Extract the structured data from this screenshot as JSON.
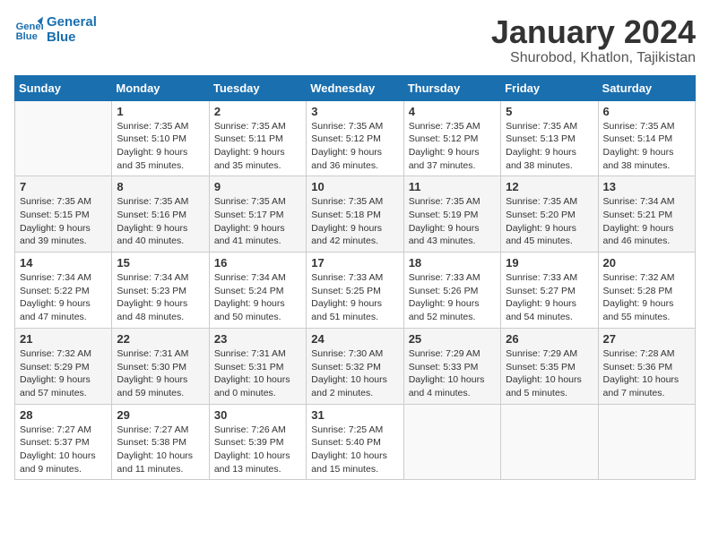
{
  "logo": {
    "line1": "General",
    "line2": "Blue"
  },
  "title": "January 2024",
  "subtitle": "Shurobod, Khatlon, Tajikistan",
  "days_of_week": [
    "Sunday",
    "Monday",
    "Tuesday",
    "Wednesday",
    "Thursday",
    "Friday",
    "Saturday"
  ],
  "weeks": [
    [
      {
        "day": "",
        "info": ""
      },
      {
        "day": "1",
        "info": "Sunrise: 7:35 AM\nSunset: 5:10 PM\nDaylight: 9 hours\nand 35 minutes."
      },
      {
        "day": "2",
        "info": "Sunrise: 7:35 AM\nSunset: 5:11 PM\nDaylight: 9 hours\nand 35 minutes."
      },
      {
        "day": "3",
        "info": "Sunrise: 7:35 AM\nSunset: 5:12 PM\nDaylight: 9 hours\nand 36 minutes."
      },
      {
        "day": "4",
        "info": "Sunrise: 7:35 AM\nSunset: 5:12 PM\nDaylight: 9 hours\nand 37 minutes."
      },
      {
        "day": "5",
        "info": "Sunrise: 7:35 AM\nSunset: 5:13 PM\nDaylight: 9 hours\nand 38 minutes."
      },
      {
        "day": "6",
        "info": "Sunrise: 7:35 AM\nSunset: 5:14 PM\nDaylight: 9 hours\nand 38 minutes."
      }
    ],
    [
      {
        "day": "7",
        "info": "Sunrise: 7:35 AM\nSunset: 5:15 PM\nDaylight: 9 hours\nand 39 minutes."
      },
      {
        "day": "8",
        "info": "Sunrise: 7:35 AM\nSunset: 5:16 PM\nDaylight: 9 hours\nand 40 minutes."
      },
      {
        "day": "9",
        "info": "Sunrise: 7:35 AM\nSunset: 5:17 PM\nDaylight: 9 hours\nand 41 minutes."
      },
      {
        "day": "10",
        "info": "Sunrise: 7:35 AM\nSunset: 5:18 PM\nDaylight: 9 hours\nand 42 minutes."
      },
      {
        "day": "11",
        "info": "Sunrise: 7:35 AM\nSunset: 5:19 PM\nDaylight: 9 hours\nand 43 minutes."
      },
      {
        "day": "12",
        "info": "Sunrise: 7:35 AM\nSunset: 5:20 PM\nDaylight: 9 hours\nand 45 minutes."
      },
      {
        "day": "13",
        "info": "Sunrise: 7:34 AM\nSunset: 5:21 PM\nDaylight: 9 hours\nand 46 minutes."
      }
    ],
    [
      {
        "day": "14",
        "info": "Sunrise: 7:34 AM\nSunset: 5:22 PM\nDaylight: 9 hours\nand 47 minutes."
      },
      {
        "day": "15",
        "info": "Sunrise: 7:34 AM\nSunset: 5:23 PM\nDaylight: 9 hours\nand 48 minutes."
      },
      {
        "day": "16",
        "info": "Sunrise: 7:34 AM\nSunset: 5:24 PM\nDaylight: 9 hours\nand 50 minutes."
      },
      {
        "day": "17",
        "info": "Sunrise: 7:33 AM\nSunset: 5:25 PM\nDaylight: 9 hours\nand 51 minutes."
      },
      {
        "day": "18",
        "info": "Sunrise: 7:33 AM\nSunset: 5:26 PM\nDaylight: 9 hours\nand 52 minutes."
      },
      {
        "day": "19",
        "info": "Sunrise: 7:33 AM\nSunset: 5:27 PM\nDaylight: 9 hours\nand 54 minutes."
      },
      {
        "day": "20",
        "info": "Sunrise: 7:32 AM\nSunset: 5:28 PM\nDaylight: 9 hours\nand 55 minutes."
      }
    ],
    [
      {
        "day": "21",
        "info": "Sunrise: 7:32 AM\nSunset: 5:29 PM\nDaylight: 9 hours\nand 57 minutes."
      },
      {
        "day": "22",
        "info": "Sunrise: 7:31 AM\nSunset: 5:30 PM\nDaylight: 9 hours\nand 59 minutes."
      },
      {
        "day": "23",
        "info": "Sunrise: 7:31 AM\nSunset: 5:31 PM\nDaylight: 10 hours\nand 0 minutes."
      },
      {
        "day": "24",
        "info": "Sunrise: 7:30 AM\nSunset: 5:32 PM\nDaylight: 10 hours\nand 2 minutes."
      },
      {
        "day": "25",
        "info": "Sunrise: 7:29 AM\nSunset: 5:33 PM\nDaylight: 10 hours\nand 4 minutes."
      },
      {
        "day": "26",
        "info": "Sunrise: 7:29 AM\nSunset: 5:35 PM\nDaylight: 10 hours\nand 5 minutes."
      },
      {
        "day": "27",
        "info": "Sunrise: 7:28 AM\nSunset: 5:36 PM\nDaylight: 10 hours\nand 7 minutes."
      }
    ],
    [
      {
        "day": "28",
        "info": "Sunrise: 7:27 AM\nSunset: 5:37 PM\nDaylight: 10 hours\nand 9 minutes."
      },
      {
        "day": "29",
        "info": "Sunrise: 7:27 AM\nSunset: 5:38 PM\nDaylight: 10 hours\nand 11 minutes."
      },
      {
        "day": "30",
        "info": "Sunrise: 7:26 AM\nSunset: 5:39 PM\nDaylight: 10 hours\nand 13 minutes."
      },
      {
        "day": "31",
        "info": "Sunrise: 7:25 AM\nSunset: 5:40 PM\nDaylight: 10 hours\nand 15 minutes."
      },
      {
        "day": "",
        "info": ""
      },
      {
        "day": "",
        "info": ""
      },
      {
        "day": "",
        "info": ""
      }
    ]
  ]
}
